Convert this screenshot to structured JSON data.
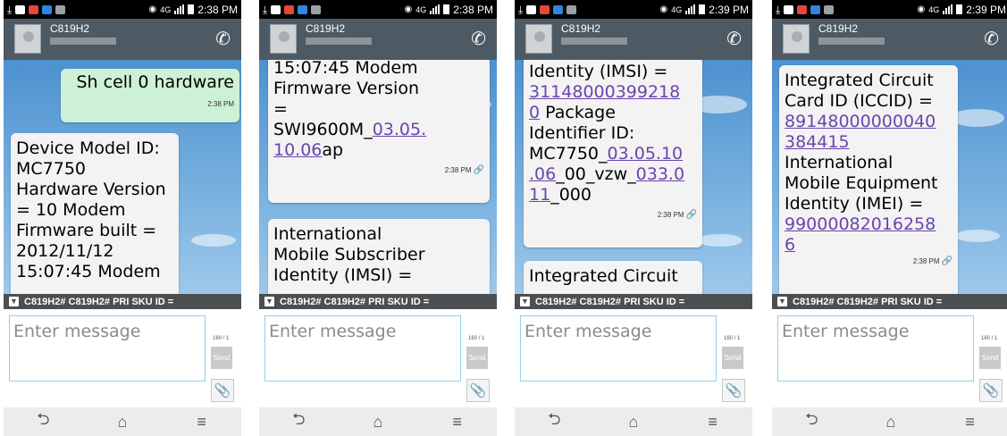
{
  "screens": [
    {
      "time": "2:38 PM",
      "net": "4G",
      "contact": "C819H2",
      "banner": "C819H2# C819H2# PRI SKU ID =",
      "input_placeholder": "Enter message",
      "char_count": "160 / 1",
      "send_label": "Send",
      "outgoing": {
        "text": "Sh cell 0 hardware",
        "time": "2:38 PM"
      },
      "incoming1": {
        "lines": [
          "Device Model ID:",
          "MC7750",
          "Hardware Version",
          "= 10 Modem",
          "Firmware built =",
          "2012/11/12",
          "15:07:45 Modem"
        ]
      }
    },
    {
      "time": "2:38 PM",
      "net": "4G",
      "contact": "C819H2",
      "banner": "C819H2# C819H2# PRI SKU ID =",
      "input_placeholder": "Enter message",
      "char_count": "160 / 1",
      "send_label": "Send",
      "incoming1": {
        "line1": "15:07:45 Modem",
        "line2": "Firmware Version",
        "line3": "=",
        "line4a": "SWI9600M_",
        "link1": "03.05.",
        "link2": "10.06",
        "line5b": "ap",
        "time": "2:38 PM"
      },
      "incoming2": {
        "lines": [
          "International",
          "Mobile Subscriber",
          "Identity (IMSI) ="
        ]
      }
    },
    {
      "time": "2:39 PM",
      "net": "4G",
      "contact": "C819H2",
      "banner": "C819H2# C819H2# PRI SKU ID =",
      "input_placeholder": "Enter message",
      "char_count": "160 / 1",
      "send_label": "Send",
      "incoming1": {
        "line1": "Identity (IMSI) =",
        "link1": "31148000399218",
        "link2": "0",
        "line2b": " Package",
        "line3": "Identifier ID:",
        "line4a": "MC7750_",
        "link3": "03.05.10",
        "link4": ".06",
        "line5b": "_00_vzw_",
        "link5": "033.0",
        "link6": "11",
        "line6b": "_000",
        "time": "2:38 PM"
      },
      "incoming2": {
        "text": "Integrated Circuit"
      }
    },
    {
      "time": "2:39 PM",
      "net": "4G",
      "contact": "C819H2",
      "banner": "C819H2# C819H2# PRI SKU ID =",
      "input_placeholder": "Enter message",
      "char_count": "160 / 1",
      "send_label": "Send",
      "incoming1": {
        "line1": "Integrated Circuit",
        "line2": "Card ID (ICCID) =",
        "link1": "89148000000040",
        "link2": "384415",
        "line3": "International",
        "line4": "Mobile Equipment",
        "line5": "Identity (IMEI) =",
        "link3": "99000082016258",
        "link4": "6",
        "time": "2:38 PM"
      }
    }
  ]
}
